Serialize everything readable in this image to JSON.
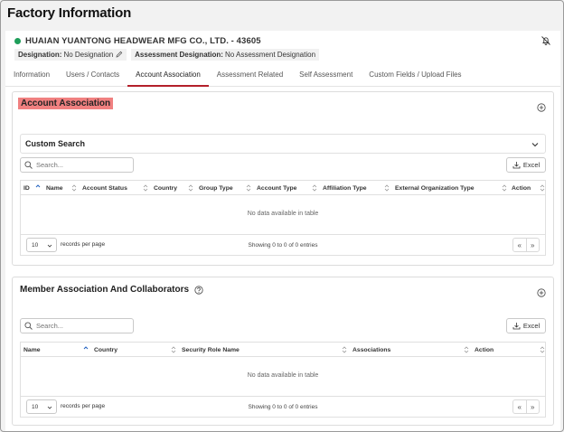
{
  "page": {
    "title": "Factory Information"
  },
  "factory": {
    "name": "HUAIAN YUANTONG HEADWEAR MFG CO., LTD. - 43605",
    "status_color": "#1e9e5a",
    "designation_label": "Designation:",
    "designation_value": "No Designation",
    "assessment_designation_label": "Assessment Designation:",
    "assessment_designation_value": "No Assessment Designation"
  },
  "tabs": [
    {
      "label": "Information"
    },
    {
      "label": "Users / Contacts"
    },
    {
      "label": "Account Association",
      "active": true
    },
    {
      "label": "Assessment Related"
    },
    {
      "label": "Self Assessment"
    },
    {
      "label": "Custom Fields / Upload Files"
    }
  ],
  "account_association": {
    "title": "Account Association",
    "highlight_color": "#f08080",
    "custom_search_label": "Custom Search",
    "search_placeholder": "Search...",
    "excel_label": "Excel",
    "columns": [
      "ID",
      "Name",
      "Account Status",
      "Country",
      "Group Type",
      "Account Type",
      "Affiliation Type",
      "External Organization Type",
      "Action"
    ],
    "empty_message": "No data available in table",
    "page_length": "10",
    "records_per_page": "records per page",
    "info": "Showing 0 to 0 of 0 entries"
  },
  "member_association": {
    "title": "Member Association And Collaborators",
    "search_placeholder": "Search...",
    "excel_label": "Excel",
    "columns": [
      "Name",
      "Country",
      "Security Role Name",
      "Associations",
      "Action"
    ],
    "empty_message": "No data available in table",
    "page_length": "10",
    "records_per_page": "records per page",
    "info": "Showing 0 to 0 of 0 entries"
  },
  "pager": {
    "prev": "«",
    "next": "»"
  }
}
